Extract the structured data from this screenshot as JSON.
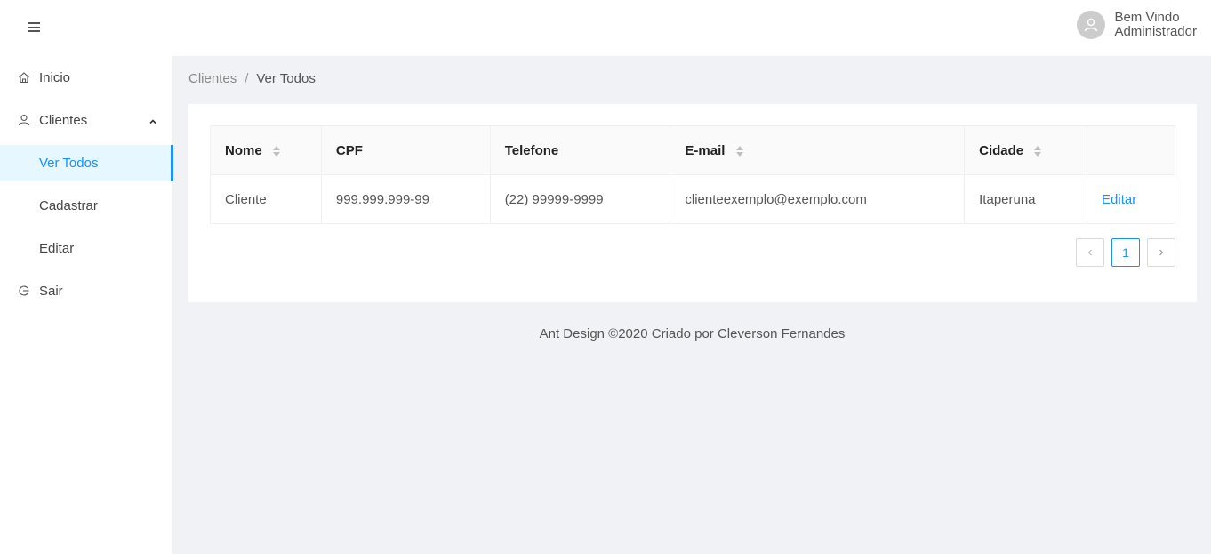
{
  "header": {
    "menu_icon": "menu-icon",
    "user_greeting": "Bem Vindo",
    "user_name": "Administrador"
  },
  "sidebar": {
    "items": [
      {
        "label": "Inicio",
        "icon": "home-icon"
      },
      {
        "label": "Clientes",
        "icon": "user-icon",
        "expanded": true
      },
      {
        "label": "Ver Todos",
        "active": true
      },
      {
        "label": "Cadastrar"
      },
      {
        "label": "Editar"
      },
      {
        "label": "Sair",
        "icon": "logout-icon"
      }
    ]
  },
  "breadcrumb": {
    "parent": "Clientes",
    "separator": "/",
    "current": "Ver Todos"
  },
  "table": {
    "columns": [
      "Nome",
      "CPF",
      "Telefone",
      "E-mail",
      "Cidade",
      ""
    ],
    "rows": [
      {
        "nome": "Cliente",
        "cpf": "999.999.999-99",
        "telefone": "(22) 99999-9999",
        "email": "clienteexemplo@exemplo.com",
        "cidade": "Itaperuna",
        "action": "Editar"
      }
    ]
  },
  "pagination": {
    "current_page": "1"
  },
  "footer": {
    "text": "Ant Design ©2020 Criado por Cleverson Fernandes"
  },
  "colors": {
    "accent": "#1890ff",
    "background": "#f0f2f5"
  }
}
